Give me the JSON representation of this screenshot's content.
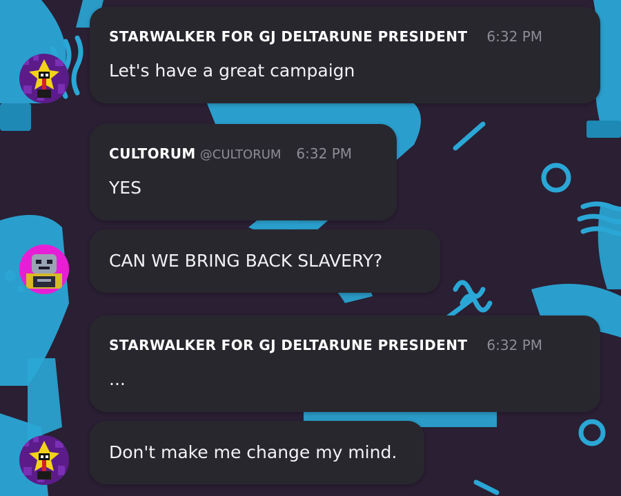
{
  "messages": [
    {
      "author": "STARWALKER FOR GJ DELTARUNE PRESIDENT",
      "handle": "",
      "time": "6:32 PM",
      "text": "Let's have a great campaign",
      "avatar": "starwalker-avatar"
    },
    {
      "author": "CULTORUM",
      "handle": "@CULTORUM",
      "time": "6:32 PM",
      "text": "YES",
      "avatar": ""
    },
    {
      "author": "",
      "handle": "",
      "time": "",
      "text": "CAN WE BRING BACK SLAVERY?",
      "avatar": "cultorum-avatar"
    },
    {
      "author": "STARWALKER FOR GJ DELTARUNE PRESIDENT",
      "handle": "",
      "time": "6:32 PM",
      "text": "...",
      "avatar": ""
    },
    {
      "author": "",
      "handle": "",
      "time": "",
      "text": "Don't make me change my mind.",
      "avatar": "starwalker-avatar"
    }
  ],
  "colors": {
    "background": "#2a1f33",
    "pattern": "#2aa7d6",
    "bubble": "#29272e",
    "text": "#ffffff",
    "muted": "#8e8c94",
    "cultorum_avatar_ring": "#e61fd6"
  }
}
